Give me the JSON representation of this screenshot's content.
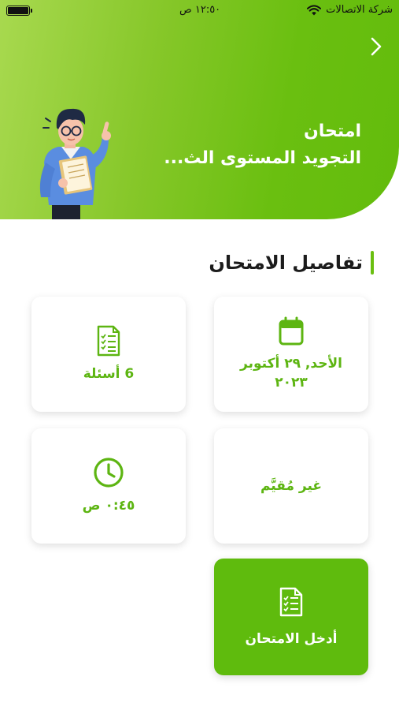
{
  "status_bar": {
    "carrier": "شركة الاتصالات",
    "time": "١٢:٥٠ ص"
  },
  "header": {
    "title_line1": "امتحان",
    "title_line2": "التجويد المستوى الث..."
  },
  "section": {
    "title": "تفاصيل الامتحان"
  },
  "cards": {
    "date": "الأحد, ٢٩ أكتوبر ٢٠٢٣",
    "questions": "6 أسئلة",
    "residency": "غير مُقيَّم",
    "duration": "٠:٤٥ ص"
  },
  "actions": {
    "enter_exam": "أدخل الامتحان"
  },
  "colors": {
    "accent": "#63bc0c",
    "card_text": "#5db512"
  },
  "icons": {
    "back": "chevron-right-icon",
    "date": "calendar-icon",
    "questions": "checklist-icon",
    "duration": "clock-icon",
    "enter": "document-icon"
  }
}
